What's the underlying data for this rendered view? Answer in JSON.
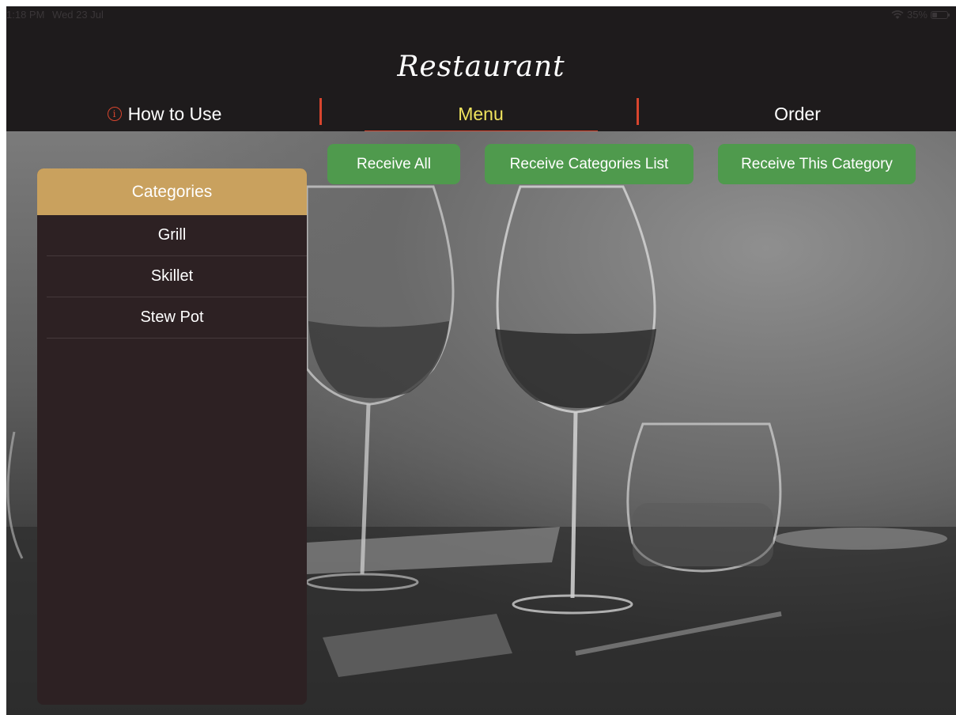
{
  "status_bar": {
    "time": "1:18 PM",
    "date": "Wed 23 Jul",
    "battery": "35%",
    "battery_level": 0.35,
    "icons": [
      "wifi-icon",
      "battery-icon"
    ]
  },
  "header": {
    "title": "Restaurant",
    "tabs": [
      {
        "label": "How to Use",
        "icon": "info-icon",
        "active": false
      },
      {
        "label": "Menu",
        "active": true
      },
      {
        "label": "Order",
        "active": false
      }
    ]
  },
  "actions": {
    "receive_all": "Receive All",
    "receive_categories": "Receive Categories List",
    "receive_this": "Receive This Category"
  },
  "categories": {
    "title": "Categories",
    "items": [
      "Grill",
      "Skillet",
      "Stew Pot"
    ]
  },
  "colors": {
    "header_bg": "#1e1b1c",
    "accent_red": "#d8452e",
    "active_tab": "#f1e45e",
    "button_green": "#4f9a4d",
    "panel_header": "#c9a15e",
    "panel_bg": "#2d2123"
  }
}
